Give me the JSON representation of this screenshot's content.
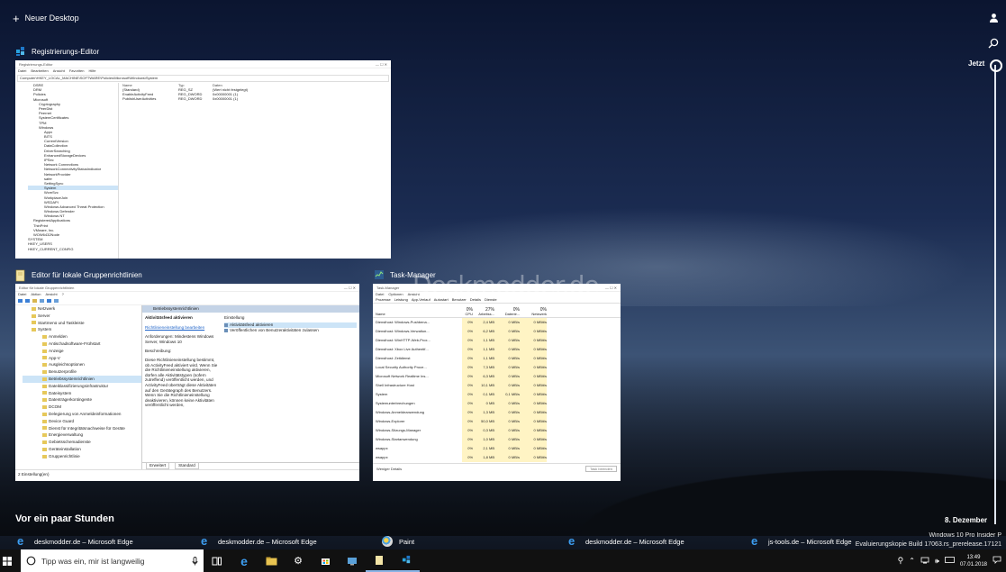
{
  "new_desktop": "Neuer Desktop",
  "timeline": {
    "now_label": "Jetzt",
    "december_label": "8. Dezember"
  },
  "section_title": "Vor ein paar Stunden",
  "windows": [
    {
      "title": "Registrierungs-Editor"
    },
    {
      "title": "Editor für lokale Gruppenrichtlinien"
    },
    {
      "title": "Task-Manager"
    }
  ],
  "regedit": {
    "titlebar": "Registrierungs-Editor",
    "menu": [
      "Datei",
      "Bearbeiten",
      "Ansicht",
      "Favoriten",
      "Hilfe"
    ],
    "address": "Computer\\HKEY_LOCAL_MACHINE\\SOFTWARE\\Policies\\Microsoft\\Windows\\System",
    "tree": [
      "DSRE",
      "DRM",
      "Policies",
      "Microsoft",
      "Cryptography",
      "PeerDist",
      "Peernet",
      "SystemCertificates",
      "TPM",
      "Windows",
      "Appx",
      "BITS",
      "CurrentVersion",
      "DataCollection",
      "DriverSearching",
      "EnhancedStorageDevices",
      "IPSec",
      "Network Connections",
      "NetworkConnectivityStatusIndicator",
      "NetworkProvider",
      "safer",
      "SettingSync",
      "System",
      "WcmSvc",
      "WorkplaceJoin",
      "WSDAPI",
      "Windows Advanced Threat Protection",
      "Windows Defender",
      "Windows NT",
      "RegisteredApplications",
      "ThinPrint",
      "VMware, Inc.",
      "WOW6432Node",
      "SYSTEM",
      "HKEY_USERS",
      "HKEY_CURRENT_CONFIG"
    ],
    "columns": [
      "Name",
      "Typ",
      "Daten"
    ],
    "values": [
      [
        "(Standard)",
        "REG_SZ",
        "(Wert nicht festgelegt)"
      ],
      [
        "EnableActivityFeed",
        "REG_DWORD",
        "0x00000001 (1)"
      ],
      [
        "PublishUserActivities",
        "REG_DWORD",
        "0x00000001 (1)"
      ]
    ]
  },
  "gpedit": {
    "titlebar": "Editor für lokale Gruppenrichtlinien",
    "menu": [
      "Datei",
      "Aktion",
      "Ansicht",
      "?"
    ],
    "tree": [
      "Netzwerk",
      "Server",
      "Startmenü und Taskleiste",
      "System",
      "Anmelden",
      "Antischadsoftware-Frühstart",
      "Anzeige",
      "App-V",
      "Ausgleichsoptionen",
      "Benutzerprofile",
      "Betriebssystemrichtlinien",
      "Dateiklassifizierungsinfrastruktur",
      "Dateisystem",
      "Datenträgerkontingente",
      "DCOM",
      "Delegierung von Anmeldeinformationen",
      "Device Guard",
      "Dienst für Integritätsnachweise für Geräte",
      "Energieverwaltung",
      "Gebietsschemadienste",
      "Geräteinstallation",
      "Gruppenrichtlinie"
    ],
    "panel_header": "Betriebssystemrichtlinien",
    "policy_title": "Aktivitätsfeed aktivieren",
    "edit_link": "Richtlinieneinstellung bearbeiten",
    "requirements": "Anforderungen: Mindestens Windows Server, Windows 10",
    "desc_label": "Beschreibung:",
    "description": "Diese Richtlinieneinstellung bestimmt, ob ActivityFeed aktiviert wird. Wenn Sie die Richtlinieneinstellung aktivieren, dürfen alle Aktivitätstypen (sofern zutreffend) veröffentlicht werden, und ActivityFeed überträgt diese Aktivitäten auf den Gerätegraph des Benutzers. Wenn Sie die Richtlinieneinstellung deaktivieren, können keine Aktivitäten veröffentlicht werden,",
    "settings_header": "Einstellung",
    "settings": [
      "Aktivitätsfeed aktivieren",
      "Veröffentlichen von Benutzeraktivitäten zulassen"
    ],
    "tabs": [
      "Erweitert",
      "Standard"
    ],
    "status": "2 Einstellung(en)"
  },
  "taskmgr": {
    "titlebar": "Task-Manager",
    "menu": [
      "Datei",
      "Optionen",
      "Ansicht"
    ],
    "tabs": [
      "Prozesse",
      "Leistung",
      "App-Verlauf",
      "Autostart",
      "Benutzer",
      "Details",
      "Dienste"
    ],
    "headers": {
      "name": "Name",
      "cpu_pct": "0%",
      "cpu": "CPU",
      "mem_pct": "27%",
      "mem": "Arbeitss...",
      "disk_pct": "0%",
      "disk": "Datentr...",
      "net_pct": "0%",
      "net": "Netzwerk"
    },
    "rows": [
      [
        "Diensthost: Windows-Pushbena...",
        "0%",
        "2,4 MB",
        "0 MB/s",
        "0 MBit/s"
      ],
      [
        "Diensthost: Windows-Verwaltun...",
        "0%",
        "6,2 MB",
        "0 MB/s",
        "0 MBit/s"
      ],
      [
        "Diensthost: WinHTTP-Web-Prox...",
        "0%",
        "1,1 MB",
        "0 MB/s",
        "0 MBit/s"
      ],
      [
        "Diensthost: Xbox Live Authentif...",
        "0%",
        "1,1 MB",
        "0 MB/s",
        "0 MBit/s"
      ],
      [
        "Diensthost: Zeitdienst",
        "0%",
        "1,1 MB",
        "0 MB/s",
        "0 MBit/s"
      ],
      [
        "Local Security Authority Proce...",
        "0%",
        "7,3 MB",
        "0 MB/s",
        "0 MBit/s"
      ],
      [
        "Microsoft Network Realtime Ins...",
        "0%",
        "6,3 MB",
        "0 MB/s",
        "0 MBit/s"
      ],
      [
        "Shell Infrastructure Host",
        "0%",
        "10,1 MB",
        "0 MB/s",
        "0 MBit/s"
      ],
      [
        "System",
        "0%",
        "0,1 MB",
        "0,1 MB/s",
        "0 MBit/s"
      ],
      [
        "Systemunterbrechungen",
        "0%",
        "0 MB",
        "0 MB/s",
        "0 MBit/s"
      ],
      [
        "Windows-Anmeldeanwendung",
        "0%",
        "1,3 MB",
        "0 MB/s",
        "0 MBit/s"
      ],
      [
        "Windows-Explorer",
        "0%",
        "50,0 MB",
        "0 MB/s",
        "0 MBit/s"
      ],
      [
        "Windows-Sitzungs-Manager",
        "0%",
        "0,3 MB",
        "0 MB/s",
        "0 MBit/s"
      ],
      [
        "Windows-Startanwendung",
        "0%",
        "1,0 MB",
        "0 MB/s",
        "0 MBit/s"
      ],
      [
        "wsappx",
        "0%",
        "2,1 MB",
        "0 MB/s",
        "0 MBit/s"
      ],
      [
        "wsappx",
        "0%",
        "1,8 MB",
        "0 MB/s",
        "0 MBit/s"
      ]
    ],
    "fewer_details": "Weniger Details",
    "end_task": "Task beenden"
  },
  "activities": [
    {
      "label": "deskmodder.de – Microsoft Edge",
      "icon": "edge-icon"
    },
    {
      "label": "deskmodder.de – Microsoft Edge",
      "icon": "edge-icon"
    },
    {
      "label": "Paint",
      "icon": "paint-icon"
    },
    {
      "label": "deskmodder.de – Microsoft Edge",
      "icon": "edge-icon"
    },
    {
      "label": "js-tools.de – Microsoft Edge",
      "icon": "edge-icon"
    }
  ],
  "watermark": {
    "line1": "Windows 10 Pro Insider P",
    "line2": "Evaluierungskopie Build 17063.rs_prerelease.17121"
  },
  "site_watermark": "Deskmodder.de",
  "taskbar": {
    "search_placeholder": "Tipp was ein, mir ist langweilig",
    "time": "13:49",
    "date": "07.01.2018"
  },
  "colors": {
    "accent": "#0078d7",
    "taskbar_bg": "#111111",
    "timeline": "#dfe5ee"
  }
}
